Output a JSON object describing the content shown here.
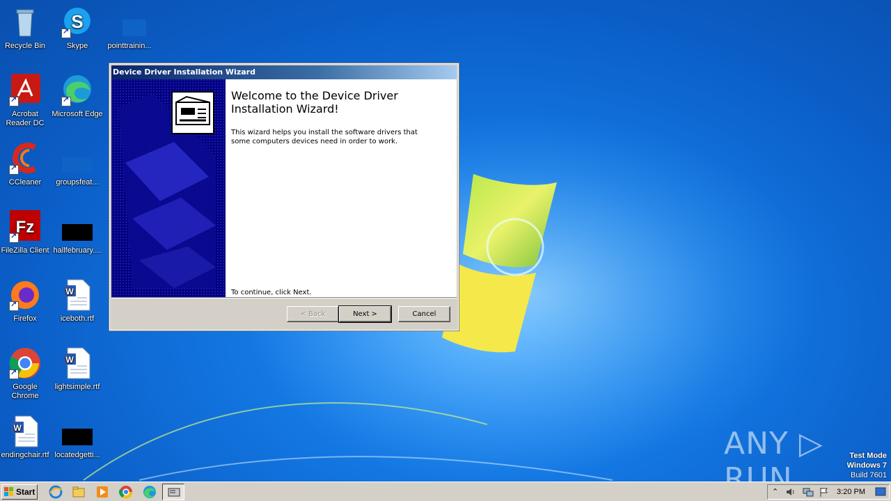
{
  "desktop": {
    "icons": [
      {
        "label": "Recycle Bin"
      },
      {
        "label": "Skype"
      },
      {
        "label": "pointtrainin..."
      },
      {
        "label": "Acrobat Reader DC"
      },
      {
        "label": "Microsoft Edge"
      },
      {
        "label": "CCleaner"
      },
      {
        "label": "groupsfeat..."
      },
      {
        "label": "FileZilla Client"
      },
      {
        "label": "hallfebruary...."
      },
      {
        "label": "Firefox"
      },
      {
        "label": "iceboth.rtf"
      },
      {
        "label": "Google Chrome"
      },
      {
        "label": "lightsimple.rtf"
      },
      {
        "label": "endingchair.rtf"
      },
      {
        "label": "locatedgetti..."
      }
    ]
  },
  "wizard": {
    "title": "Device Driver Installation Wizard",
    "heading": "Welcome to the Device Driver Installation Wizard!",
    "description": "This wizard helps you install the software drivers that some computers devices need in order to work.",
    "continue_text": "To continue, click Next.",
    "buttons": {
      "back": "< Back",
      "next": "Next >",
      "cancel": "Cancel"
    }
  },
  "watermark": {
    "brand": "ANY ▷ RUN",
    "mode_line1": "Test Mode",
    "mode_line2": "Windows 7",
    "mode_line3": "Build 7601"
  },
  "taskbar": {
    "start_label": "Start",
    "clock": "3:20 PM"
  }
}
